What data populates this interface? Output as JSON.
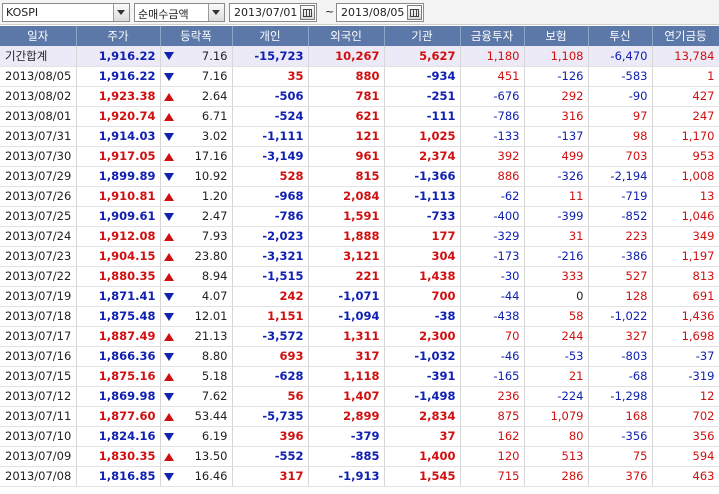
{
  "toolbar": {
    "market": "KOSPI",
    "metric": "순매수금액",
    "start_date": "2013/07/01",
    "separator": "~",
    "end_date": "2013/08/05"
  },
  "columns": [
    "일자",
    "주가",
    "등락폭",
    "개인",
    "외국인",
    "기관",
    "금융투자",
    "보험",
    "투신",
    "연기금등"
  ],
  "rows": [
    {
      "date": "기간합계",
      "price": "1,916.22",
      "dir": "down",
      "change": "7.16",
      "personal": "-15,723",
      "foreign": "10,267",
      "inst": "5,627",
      "fin": "1,180",
      "ins": "1,108",
      "trust": "-6,470",
      "pension": "13,784",
      "total": true
    },
    {
      "date": "2013/08/05",
      "price": "1,916.22",
      "dir": "down",
      "change": "7.16",
      "personal": "35",
      "foreign": "880",
      "inst": "-934",
      "fin": "451",
      "ins": "-126",
      "trust": "-583",
      "pension": "1"
    },
    {
      "date": "2013/08/02",
      "price": "1,923.38",
      "dir": "up",
      "change": "2.64",
      "personal": "-506",
      "foreign": "781",
      "inst": "-251",
      "fin": "-676",
      "ins": "292",
      "trust": "-90",
      "pension": "427"
    },
    {
      "date": "2013/08/01",
      "price": "1,920.74",
      "dir": "up",
      "change": "6.71",
      "personal": "-524",
      "foreign": "621",
      "inst": "-111",
      "fin": "-786",
      "ins": "316",
      "trust": "97",
      "pension": "247"
    },
    {
      "date": "2013/07/31",
      "price": "1,914.03",
      "dir": "down",
      "change": "3.02",
      "personal": "-1,111",
      "foreign": "121",
      "inst": "1,025",
      "fin": "-133",
      "ins": "-137",
      "trust": "98",
      "pension": "1,170"
    },
    {
      "date": "2013/07/30",
      "price": "1,917.05",
      "dir": "up",
      "change": "17.16",
      "personal": "-3,149",
      "foreign": "961",
      "inst": "2,374",
      "fin": "392",
      "ins": "499",
      "trust": "703",
      "pension": "953"
    },
    {
      "date": "2013/07/29",
      "price": "1,899.89",
      "dir": "down",
      "change": "10.92",
      "personal": "528",
      "foreign": "815",
      "inst": "-1,366",
      "fin": "886",
      "ins": "-326",
      "trust": "-2,194",
      "pension": "1,008"
    },
    {
      "date": "2013/07/26",
      "price": "1,910.81",
      "dir": "up",
      "change": "1.20",
      "personal": "-968",
      "foreign": "2,084",
      "inst": "-1,113",
      "fin": "-62",
      "ins": "11",
      "trust": "-719",
      "pension": "13"
    },
    {
      "date": "2013/07/25",
      "price": "1,909.61",
      "dir": "down",
      "change": "2.47",
      "personal": "-786",
      "foreign": "1,591",
      "inst": "-733",
      "fin": "-400",
      "ins": "-399",
      "trust": "-852",
      "pension": "1,046"
    },
    {
      "date": "2013/07/24",
      "price": "1,912.08",
      "dir": "up",
      "change": "7.93",
      "personal": "-2,023",
      "foreign": "1,888",
      "inst": "177",
      "fin": "-329",
      "ins": "31",
      "trust": "223",
      "pension": "349"
    },
    {
      "date": "2013/07/23",
      "price": "1,904.15",
      "dir": "up",
      "change": "23.80",
      "personal": "-3,321",
      "foreign": "3,121",
      "inst": "304",
      "fin": "-173",
      "ins": "-216",
      "trust": "-386",
      "pension": "1,197"
    },
    {
      "date": "2013/07/22",
      "price": "1,880.35",
      "dir": "up",
      "change": "8.94",
      "personal": "-1,515",
      "foreign": "221",
      "inst": "1,438",
      "fin": "-30",
      "ins": "333",
      "trust": "527",
      "pension": "813"
    },
    {
      "date": "2013/07/19",
      "price": "1,871.41",
      "dir": "down",
      "change": "4.07",
      "personal": "242",
      "foreign": "-1,071",
      "inst": "700",
      "fin": "-44",
      "ins": "0",
      "trust": "128",
      "pension": "691"
    },
    {
      "date": "2013/07/18",
      "price": "1,875.48",
      "dir": "down",
      "change": "12.01",
      "personal": "1,151",
      "foreign": "-1,094",
      "inst": "-38",
      "fin": "-438",
      "ins": "58",
      "trust": "-1,022",
      "pension": "1,436"
    },
    {
      "date": "2013/07/17",
      "price": "1,887.49",
      "dir": "up",
      "change": "21.13",
      "personal": "-3,572",
      "foreign": "1,311",
      "inst": "2,300",
      "fin": "70",
      "ins": "244",
      "trust": "327",
      "pension": "1,698"
    },
    {
      "date": "2013/07/16",
      "price": "1,866.36",
      "dir": "down",
      "change": "8.80",
      "personal": "693",
      "foreign": "317",
      "inst": "-1,032",
      "fin": "-46",
      "ins": "-53",
      "trust": "-803",
      "pension": "-37"
    },
    {
      "date": "2013/07/15",
      "price": "1,875.16",
      "dir": "up",
      "change": "5.18",
      "personal": "-628",
      "foreign": "1,118",
      "inst": "-391",
      "fin": "-165",
      "ins": "21",
      "trust": "-68",
      "pension": "-319"
    },
    {
      "date": "2013/07/12",
      "price": "1,869.98",
      "dir": "down",
      "change": "7.62",
      "personal": "56",
      "foreign": "1,407",
      "inst": "-1,498",
      "fin": "236",
      "ins": "-224",
      "trust": "-1,298",
      "pension": "12"
    },
    {
      "date": "2013/07/11",
      "price": "1,877.60",
      "dir": "up",
      "change": "53.44",
      "personal": "-5,735",
      "foreign": "2,899",
      "inst": "2,834",
      "fin": "875",
      "ins": "1,079",
      "trust": "168",
      "pension": "702"
    },
    {
      "date": "2013/07/10",
      "price": "1,824.16",
      "dir": "down",
      "change": "6.19",
      "personal": "396",
      "foreign": "-379",
      "inst": "37",
      "fin": "162",
      "ins": "80",
      "trust": "-356",
      "pension": "356"
    },
    {
      "date": "2013/07/09",
      "price": "1,830.35",
      "dir": "up",
      "change": "13.50",
      "personal": "-552",
      "foreign": "-885",
      "inst": "1,400",
      "fin": "120",
      "ins": "513",
      "trust": "75",
      "pension": "594"
    },
    {
      "date": "2013/07/08",
      "price": "1,816.85",
      "dir": "down",
      "change": "16.46",
      "personal": "317",
      "foreign": "-1,913",
      "inst": "1,545",
      "fin": "715",
      "ins": "286",
      "trust": "376",
      "pension": "463"
    }
  ],
  "colors": {
    "header_bg": "#5b78a8",
    "up": "#d01010",
    "down": "#1020b0",
    "total_bg": "#eceaf6"
  }
}
